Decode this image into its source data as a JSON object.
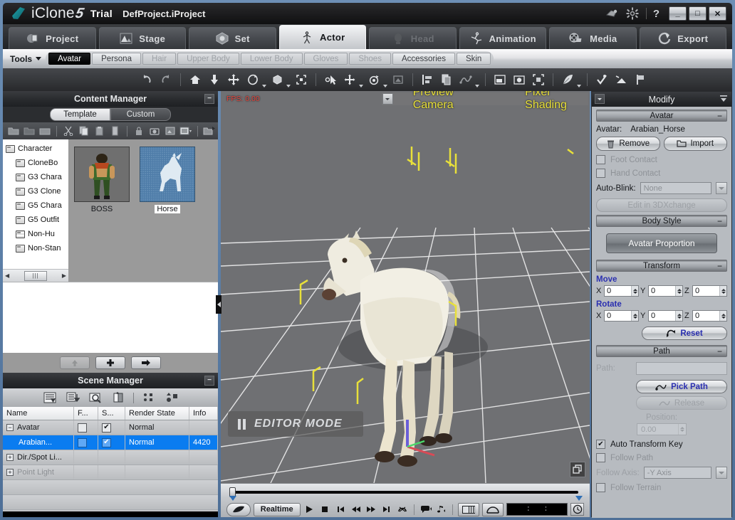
{
  "window": {
    "brand": "iClone",
    "brand_number": "5",
    "edition": "Trial",
    "project_name": "DefProject.iProject",
    "help_label": "?",
    "minimize_label": "_",
    "maximize_label": "□",
    "close_label": "✕",
    "icons": {
      "plugin": "plugin-icon",
      "settings": "gear-icon"
    }
  },
  "main_tabs": [
    {
      "label": "Project",
      "icon": "project-icon",
      "state": "normal"
    },
    {
      "label": "Stage",
      "icon": "stage-icon",
      "state": "normal"
    },
    {
      "label": "Set",
      "icon": "set-icon",
      "state": "normal"
    },
    {
      "label": "Actor",
      "icon": "actor-icon",
      "state": "active"
    },
    {
      "label": "Head",
      "icon": "head-icon",
      "state": "disabled"
    },
    {
      "label": "Animation",
      "icon": "animation-icon",
      "state": "normal"
    },
    {
      "label": "Media",
      "icon": "media-icon",
      "state": "normal"
    },
    {
      "label": "Export",
      "icon": "export-icon",
      "state": "normal"
    }
  ],
  "sub_bar": {
    "tools_label": "Tools",
    "tabs": [
      {
        "label": "Avatar",
        "state": "active"
      },
      {
        "label": "Persona",
        "state": "normal"
      },
      {
        "label": "Hair",
        "state": "disabled"
      },
      {
        "label": "Upper Body",
        "state": "disabled"
      },
      {
        "label": "Lower Body",
        "state": "disabled"
      },
      {
        "label": "Gloves",
        "state": "disabled"
      },
      {
        "label": "Shoes",
        "state": "disabled"
      },
      {
        "label": "Accessories",
        "state": "normal"
      },
      {
        "label": "Skin",
        "state": "normal"
      }
    ]
  },
  "icon_toolbar": [
    "undo-icon",
    "redo-icon",
    "sep",
    "home-icon",
    "drop-to-floor-icon",
    "move-icon",
    "rotate-icon",
    "scale-icon",
    "fit-icon",
    "sep",
    "select-icon",
    "transform-gizmo-icon",
    "orbit-icon",
    "render-region-icon",
    "sep",
    "align-icon",
    "duplicate-icon",
    "motion-path-icon",
    "sep",
    "preview-window-icon",
    "snapshot-icon",
    "fullscreen-icon",
    "sep",
    "feather-icon",
    "sep",
    "pick-key-icon",
    "light-icon",
    "flag-icon"
  ],
  "content_manager": {
    "title": "Content Manager",
    "minimize_label": "−",
    "tabs": [
      {
        "label": "Template",
        "state": "active"
      },
      {
        "label": "Custom",
        "state": "inactive"
      }
    ],
    "toolbar_icons": [
      "new-folder-icon",
      "open-folder-icon",
      "close-folder-icon",
      "sep",
      "cut-icon",
      "copy-icon",
      "paste-icon",
      "delete-icon",
      "sep",
      "lock-icon",
      "camera-icon",
      "thumbnail-icon",
      "list-view-icon",
      "sep",
      "export-folder-icon"
    ],
    "tree": [
      {
        "label": "Character",
        "level": 0,
        "icon": "folder-icon"
      },
      {
        "label": "CloneBo",
        "level": 1,
        "icon": "folder-icon"
      },
      {
        "label": "G3 Chara",
        "level": 1,
        "icon": "folder-icon"
      },
      {
        "label": "G3 Clone",
        "level": 1,
        "icon": "folder-icon"
      },
      {
        "label": "G5 Chara",
        "level": 1,
        "icon": "folder-icon"
      },
      {
        "label": "G5 Outfit",
        "level": 1,
        "icon": "folder-icon"
      },
      {
        "label": "Non-Hu",
        "level": 1,
        "icon": "folder-grid-icon"
      },
      {
        "label": "Non-Stan",
        "level": 1,
        "icon": "folder-icon"
      }
    ],
    "assets": [
      {
        "label": "BOSS",
        "selected": false
      },
      {
        "label": "Horse",
        "selected": true
      }
    ],
    "footer_buttons": [
      "up-button",
      "add-button",
      "apply-button"
    ]
  },
  "scene_manager": {
    "title": "Scene Manager",
    "minimize_label": "−",
    "toolbar_icons": [
      "filter-icon",
      "sort-icon",
      "find-icon",
      "copy-object-icon",
      "sep",
      "select-all-icon",
      "arrange-icon"
    ],
    "columns": [
      "Name",
      "F...",
      "S...",
      "Render State",
      "Info"
    ],
    "rows": [
      {
        "name": "Avatar",
        "expander": "−",
        "freeze": false,
        "show": true,
        "render_state": "Normal",
        "info": "",
        "selected": false,
        "dim": false,
        "indent": 0
      },
      {
        "name": "Arabian...",
        "expander": "",
        "freeze": false,
        "show": true,
        "render_state": "Normal",
        "info": "4420",
        "selected": true,
        "dim": false,
        "indent": 1
      },
      {
        "name": "Dir./Spot Li...",
        "expander": "+",
        "freeze": null,
        "show": null,
        "render_state": "",
        "info": "",
        "selected": false,
        "dim": false,
        "indent": 0
      },
      {
        "name": "Point Light",
        "expander": "+",
        "freeze": null,
        "show": null,
        "render_state": "",
        "info": "",
        "selected": false,
        "dim": true,
        "indent": 0
      }
    ]
  },
  "viewport": {
    "fps_label": "FPS: 0.00",
    "camera_label": "Preview Camera",
    "shading_label": "Pixel Shading",
    "editor_mode_label": "EDITOR MODE",
    "collapse_icon": "collapse-left-icon",
    "window_icon": "restore-window-icon",
    "colors": {
      "floor": "#6f7073",
      "grid_line": "#e8e8e8",
      "gizmo_yellow": "#e8e03a",
      "fps_red": "#e8453c",
      "label_yellow": "#e8e03a"
    }
  },
  "timeline": {
    "realtime_label": "Realtime",
    "timecode": ":      :",
    "buttons": [
      "render-mode-button",
      "realtime-button",
      "play-button",
      "stop-button",
      "first-frame-button",
      "prev-frame-button",
      "next-frame-button",
      "last-frame-button",
      "loop-button",
      "sep",
      "speech-icon",
      "music-icon",
      "sep",
      "timeline-button",
      "curve-button"
    ],
    "clock_icon": "clock-icon"
  },
  "modify": {
    "title": "Modify",
    "sections": {
      "avatar": {
        "header": "Avatar",
        "minus": "−",
        "field_label": "Avatar:",
        "field_value": "Arabian_Horse",
        "remove_label": "Remove",
        "import_label": "Import",
        "foot_contact_label": "Foot Contact",
        "foot_contact_checked": false,
        "hand_contact_label": "Hand Contact",
        "hand_contact_checked": false,
        "auto_blink_label": "Auto-Blink:",
        "auto_blink_value": "None",
        "edit_3dx_label": "Edit in 3DXchange"
      },
      "body_style": {
        "header": "Body Style",
        "minus": "−",
        "avatar_proportion_label": "Avatar Proportion"
      },
      "transform": {
        "header": "Transform",
        "minus": "−",
        "move_label": "Move",
        "move": {
          "x": "0",
          "y": "0",
          "z": "0"
        },
        "rotate_label": "Rotate",
        "rotate": {
          "x": "0",
          "y": "0",
          "z": "0"
        },
        "axis_x": "X",
        "axis_y": "Y",
        "axis_z": "Z",
        "reset_label": "Reset"
      },
      "path": {
        "header": "Path",
        "minus": "−",
        "path_label": "Path:",
        "path_value": "",
        "pick_path_label": "Pick Path",
        "release_label": "Release",
        "position_label": "Position:",
        "position_value": "0.00",
        "auto_transform_key_label": "Auto Transform Key",
        "auto_transform_key_checked": true,
        "follow_path_label": "Follow Path",
        "follow_path_checked": false,
        "follow_axis_label": "Follow Axis:",
        "follow_axis_value": "-Y Axis",
        "follow_terrain_label": "Follow Terrain",
        "follow_terrain_checked": false
      }
    }
  }
}
